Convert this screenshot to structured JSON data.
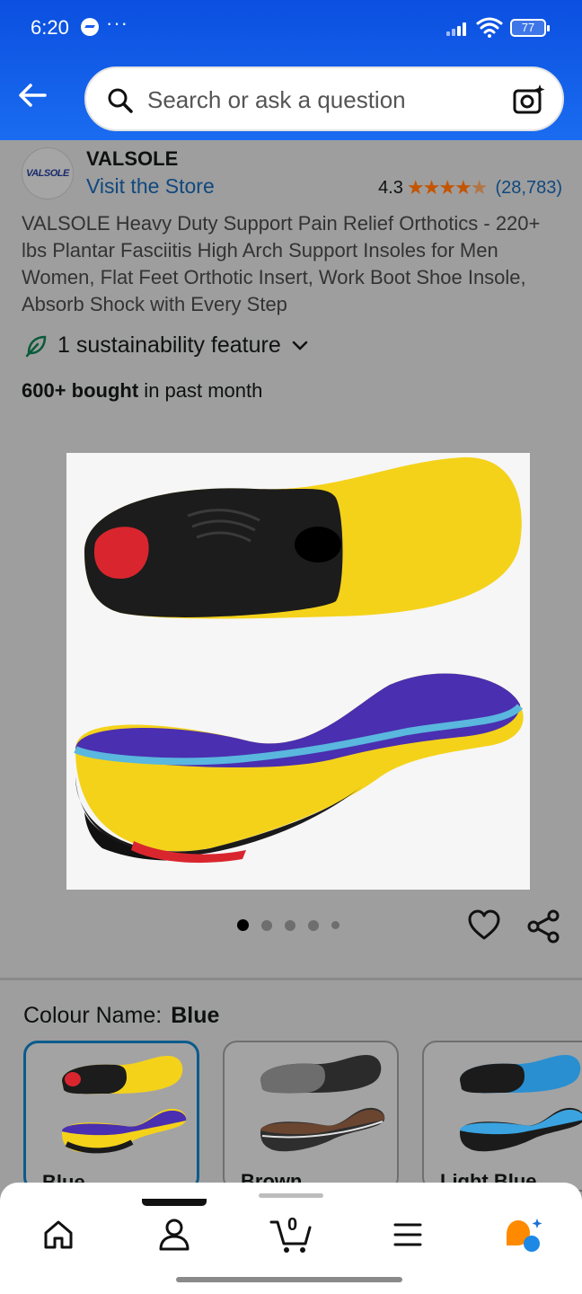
{
  "status_bar": {
    "time": "6:20",
    "more": "···",
    "battery": "77"
  },
  "search": {
    "placeholder": "Search or ask a question"
  },
  "brand": {
    "logo_text": "VALSOLE",
    "name": "VALSOLE",
    "visit_store": "Visit the Store"
  },
  "rating": {
    "value": "4.3",
    "stars": 4.3,
    "count": "(28,783)"
  },
  "product": {
    "title": "VALSOLE Heavy Duty Support Pain Relief Orthotics - 220+ lbs Plantar Fasciitis High Arch Support Insoles for Men Women, Flat Feet Orthotic Insert, Work Boot Shoe Insole, Absorb Shock with Every Step",
    "sustainability": "1 sustainability feature",
    "bought_bold": "600+ bought",
    "bought_rest": " in past month",
    "image_count": 5,
    "active_image": 1
  },
  "colour": {
    "label": "Colour Name:",
    "selected": "Blue",
    "options": [
      {
        "label": "Blue"
      },
      {
        "label": "Brown"
      },
      {
        "label": "Light Blue"
      }
    ]
  },
  "nav": {
    "items": [
      "home-icon",
      "account-icon",
      "cart-icon",
      "menu-icon",
      "rufus-icon"
    ],
    "cart_count": "0"
  },
  "colors": {
    "header": "#1a6cf0",
    "link": "#10487e",
    "stars": "#c45500",
    "selected_border": "#0b5b8c"
  }
}
